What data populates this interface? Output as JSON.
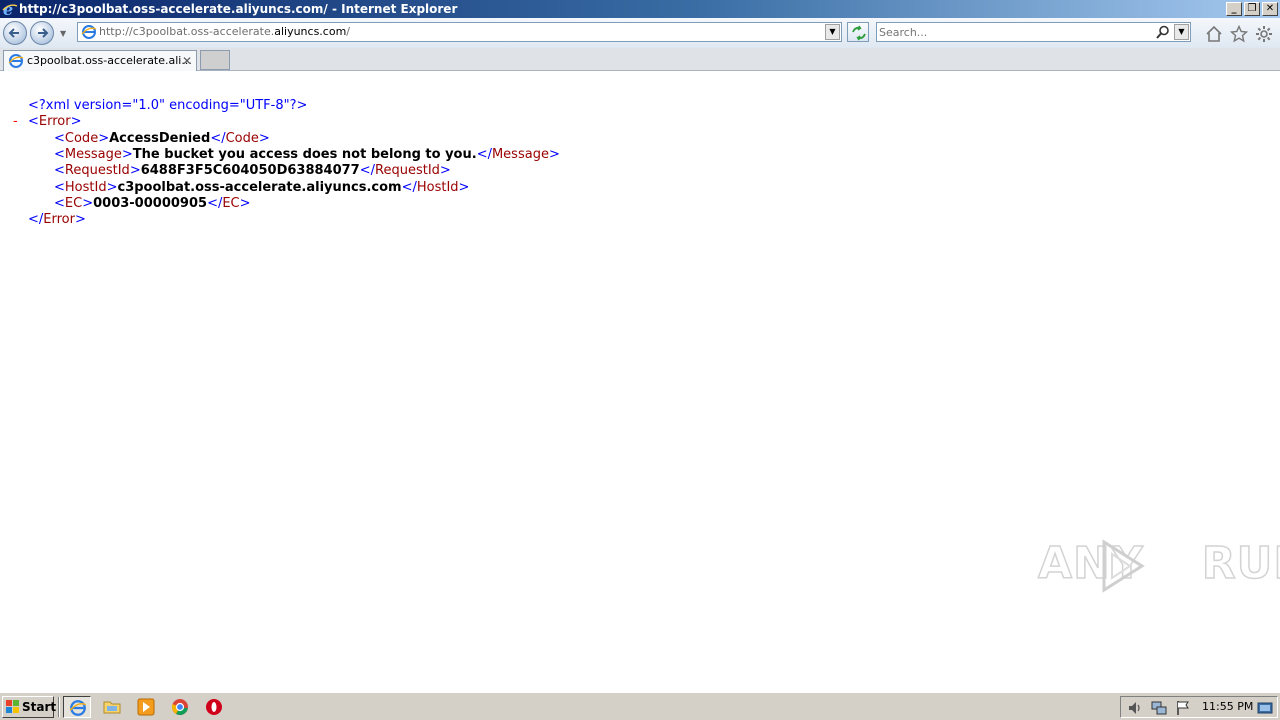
{
  "window": {
    "title": "http://c3poolbat.oss-accelerate.aliyuncs.com/ - Internet Explorer",
    "controls": [
      "_",
      "❐",
      "✕"
    ]
  },
  "address_bar": {
    "url_prefix": "http://c3poolbat.oss-accelerate.",
    "url_domain": "aliyuncs.com",
    "url_suffix": "/"
  },
  "search": {
    "placeholder": "Search..."
  },
  "tab": {
    "title": "c3poolbat.oss-accelerate.ali...",
    "close": "✕"
  },
  "xml": {
    "declaration": "<?xml version=\"1.0\" encoding=\"UTF-8\"?>",
    "collapse": "-",
    "root_open": "Error",
    "root_close": "Error",
    "fields": [
      {
        "tag": "Code",
        "value": "AccessDenied"
      },
      {
        "tag": "Message",
        "value": "The bucket you access does not belong to you."
      },
      {
        "tag": "RequestId",
        "value": "6488F3F5C604050D63884077"
      },
      {
        "tag": "HostId",
        "value": "c3poolbat.oss-accelerate.aliyuncs.com"
      },
      {
        "tag": "EC",
        "value": "0003-00000905"
      }
    ]
  },
  "watermark": {
    "left": "ANY",
    "right": "RUN"
  },
  "taskbar": {
    "start_label": "Start",
    "apps": [
      "internet-explorer-icon",
      "folder-icon",
      "media-player-icon",
      "chrome-icon",
      "opera-icon"
    ],
    "clock": "11:55 PM"
  }
}
